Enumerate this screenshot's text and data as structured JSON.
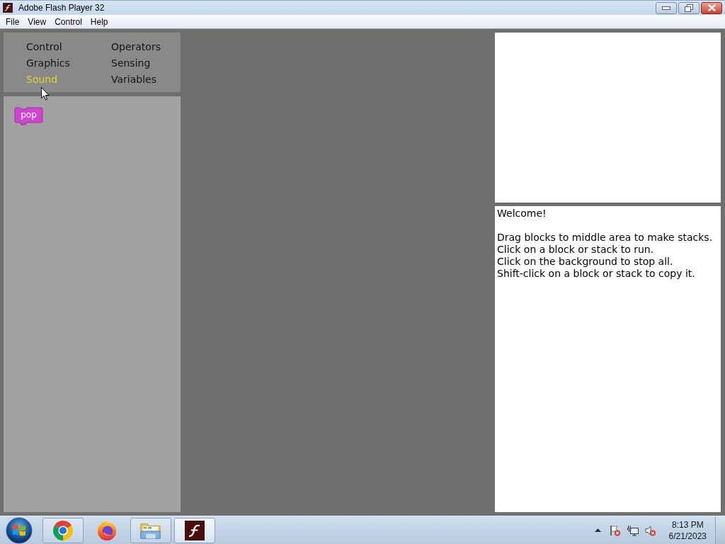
{
  "window": {
    "title": "Adobe Flash Player 32"
  },
  "menu_bar": [
    {
      "label": "File"
    },
    {
      "label": "View"
    },
    {
      "label": "Control"
    },
    {
      "label": "Help"
    }
  ],
  "palette": {
    "categories": [
      {
        "label": "Control",
        "selected": false
      },
      {
        "label": "Operators",
        "selected": false
      },
      {
        "label": "Graphics",
        "selected": false
      },
      {
        "label": "Sensing",
        "selected": false
      },
      {
        "label": "Sound",
        "selected": true
      },
      {
        "label": "Variables",
        "selected": false
      }
    ]
  },
  "blocks": [
    {
      "label": "pop"
    }
  ],
  "message_panel": {
    "heading": "Welcome!",
    "lines": [
      "Drag blocks to middle area to make stacks.",
      "Click on a block or stack to run.",
      "Click on the background to stop all.",
      "Shift-click on a block or stack to copy it."
    ]
  },
  "taskbar": {
    "apps": [
      {
        "kind": "ring",
        "running": true,
        "selected": false
      },
      {
        "kind": "fox",
        "running": false,
        "selected": false
      },
      {
        "kind": "folder",
        "running": true,
        "selected": false
      },
      {
        "kind": "flash",
        "running": true,
        "selected": true
      }
    ],
    "clock": {
      "time": "8:13 PM",
      "date": "6/21/2023"
    }
  }
}
